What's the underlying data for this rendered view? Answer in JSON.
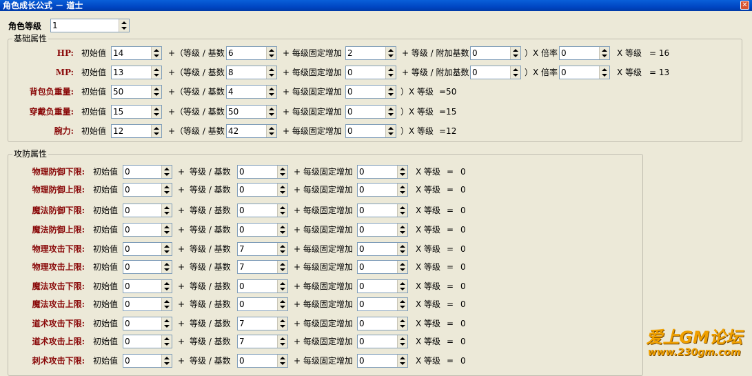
{
  "window": {
    "title": "角色成长公式 － 道士",
    "close_glyph": "✕"
  },
  "level": {
    "label": "角色等级",
    "value": "1"
  },
  "basic": {
    "legend": "基础属性",
    "rows": [
      {
        "label": "HP:",
        "t_initial": "初始值",
        "initial": "14",
        "t_open": "+（等级 / 基数",
        "base": "6",
        "t_fixed": "+ 每级固定增加",
        "fixed": "2",
        "t_extra": "+ 等级 / 附加基数",
        "extra": "0",
        "t_mult": "）X 倍率",
        "mult": "0",
        "t_level": "X 等级",
        "result": "=  16"
      },
      {
        "label": "MP:",
        "t_initial": "初始值",
        "initial": "13",
        "t_open": "+（等级 / 基数",
        "base": "8",
        "t_fixed": "+ 每级固定增加",
        "fixed": "0",
        "t_extra": "+ 等级 / 附加基数",
        "extra": "0",
        "t_mult": "）X 倍率",
        "mult": "0",
        "t_level": "X 等级",
        "result": "=  13"
      },
      {
        "label": "背包负重量:",
        "t_initial": "初始值",
        "initial": "50",
        "t_open": "+（等级 / 基数",
        "base": "4",
        "t_fixed": "+ 每级固定增加",
        "fixed": "0",
        "t_tail": "）X 等级",
        "result": "=50"
      },
      {
        "label": "穿戴负重量:",
        "t_initial": "初始值",
        "initial": "15",
        "t_open": "+（等级 / 基数",
        "base": "50",
        "t_fixed": "+ 每级固定增加",
        "fixed": "0",
        "t_tail": "）X 等级",
        "result": "=15"
      },
      {
        "label": "腕力:",
        "t_initial": "初始值",
        "initial": "12",
        "t_open": "+（等级 / 基数",
        "base": "42",
        "t_fixed": "+ 每级固定增加",
        "fixed": "0",
        "t_tail": "）X 等级",
        "result": "=12"
      }
    ]
  },
  "attack": {
    "legend": "攻防属性",
    "rows": [
      {
        "label": "物理防御下限:",
        "t_initial": "初始值",
        "initial": "0",
        "t_plus": "+",
        "t_base": "等级 / 基数",
        "base": "0",
        "t_fixed": "+ 每级固定增加",
        "fixed": "0",
        "t_level": "X 等级",
        "t_eq": "=",
        "result": "0"
      },
      {
        "label": "物理防御上限:",
        "t_initial": "初始值",
        "initial": "0",
        "t_plus": "+",
        "t_base": "等级 / 基数",
        "base": "0",
        "t_fixed": "+ 每级固定增加",
        "fixed": "0",
        "t_level": "X 等级",
        "t_eq": "=",
        "result": "0"
      },
      {
        "label": "魔法防御下限:",
        "t_initial": "初始值",
        "initial": "0",
        "t_plus": "+",
        "t_base": "等级 / 基数",
        "base": "0",
        "t_fixed": "+ 每级固定增加",
        "fixed": "0",
        "t_level": "X 等级",
        "t_eq": "=",
        "result": "0"
      },
      {
        "label": "魔法防御上限:",
        "t_initial": "初始值",
        "initial": "0",
        "t_plus": "+",
        "t_base": "等级 / 基数",
        "base": "0",
        "t_fixed": "+ 每级固定增加",
        "fixed": "0",
        "t_level": "X 等级",
        "t_eq": "=",
        "result": "0"
      },
      {
        "label": "物理攻击下限:",
        "t_initial": "初始值",
        "initial": "0",
        "t_plus": "+",
        "t_base": "等级 / 基数",
        "base": "7",
        "t_fixed": "+ 每级固定增加",
        "fixed": "0",
        "t_level": "X 等级",
        "t_eq": "=",
        "result": "0"
      },
      {
        "label": "物理攻击上限:",
        "t_initial": "初始值",
        "initial": "0",
        "t_plus": "+",
        "t_base": "等级 / 基数",
        "base": "7",
        "t_fixed": "+ 每级固定增加",
        "fixed": "0",
        "t_level": "X 等级",
        "t_eq": "=",
        "result": "0"
      },
      {
        "label": "魔法攻击下限:",
        "t_initial": "初始值",
        "initial": "0",
        "t_plus": "+",
        "t_base": "等级 / 基数",
        "base": "0",
        "t_fixed": "+ 每级固定增加",
        "fixed": "0",
        "t_level": "X 等级",
        "t_eq": "=",
        "result": "0"
      },
      {
        "label": "魔法攻击上限:",
        "t_initial": "初始值",
        "initial": "0",
        "t_plus": "+",
        "t_base": "等级 / 基数",
        "base": "0",
        "t_fixed": "+ 每级固定增加",
        "fixed": "0",
        "t_level": "X 等级",
        "t_eq": "=",
        "result": "0"
      },
      {
        "label": "道术攻击下限:",
        "t_initial": "初始值",
        "initial": "0",
        "t_plus": "+",
        "t_base": "等级 / 基数",
        "base": "7",
        "t_fixed": "+ 每级固定增加",
        "fixed": "0",
        "t_level": "X 等级",
        "t_eq": "=",
        "result": "0"
      },
      {
        "label": "道术攻击上限:",
        "t_initial": "初始值",
        "initial": "0",
        "t_plus": "+",
        "t_base": "等级 / 基数",
        "base": "7",
        "t_fixed": "+ 每级固定增加",
        "fixed": "0",
        "t_level": "X 等级",
        "t_eq": "=",
        "result": "0"
      },
      {
        "label": "刺术攻击下限:",
        "t_initial": "初始值",
        "initial": "0",
        "t_plus": "+",
        "t_base": "等级 / 基数",
        "base": "0",
        "t_fixed": "+ 每级固定增加",
        "fixed": "0",
        "t_level": "X 等级",
        "t_eq": "=",
        "result": "0"
      }
    ]
  },
  "watermark": {
    "line1": "爱上GM论坛",
    "line2": "www.230gm.com"
  }
}
